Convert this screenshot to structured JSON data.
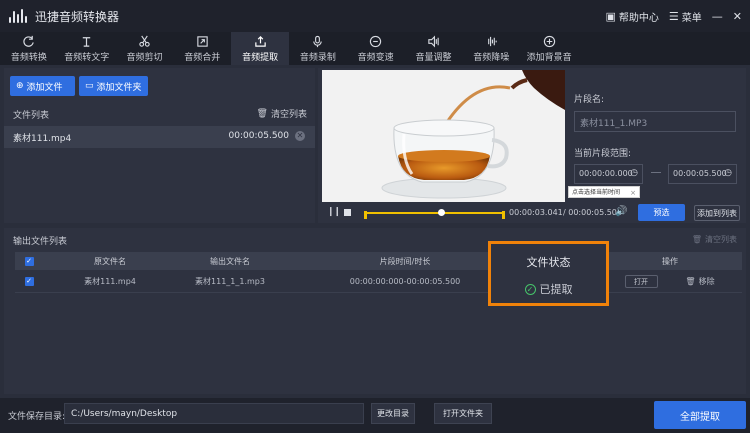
{
  "app": {
    "title": "迅捷音频转换器",
    "help_label": "帮助中心",
    "menu_label": "菜单"
  },
  "toolbar": {
    "tabs": [
      {
        "label": "音频转换",
        "icon": "refresh-icon"
      },
      {
        "label": "音频转文字",
        "icon": "text-icon"
      },
      {
        "label": "音频剪切",
        "icon": "scissors-icon"
      },
      {
        "label": "音频合并",
        "icon": "merge-icon"
      },
      {
        "label": "音频提取",
        "icon": "upload-icon",
        "active": true
      },
      {
        "label": "音频录制",
        "icon": "mic-icon"
      },
      {
        "label": "音频变速",
        "icon": "speed-icon"
      },
      {
        "label": "音量调整",
        "icon": "volume-icon"
      },
      {
        "label": "音频降噪",
        "icon": "noise-icon"
      },
      {
        "label": "添加背景音",
        "icon": "music-add-icon"
      }
    ]
  },
  "left": {
    "add_file": "添加文件",
    "add_folder": "添加文件夹",
    "list_title": "文件列表",
    "clear_list": "清空列表",
    "file": {
      "name": "素材111.mp4",
      "duration": "00:00:05.500"
    }
  },
  "player": {
    "current_time": "00:00:03.041",
    "total_time": "/ 00:00:05.504",
    "preview": "预选",
    "add_to_list": "添加到列表"
  },
  "segment": {
    "name_label": "片段名:",
    "name_value": "素材111_1.MP3",
    "range_label": "当前片段范围:",
    "start": "00:00:00.000",
    "end": "00:00:05.500",
    "tooltip": "点击选择当前时间"
  },
  "output": {
    "title": "输出文件列表",
    "clear": "清空列表",
    "columns": [
      "原文件名",
      "输出文件名",
      "片段时间/时长",
      "文件状态",
      "操作"
    ],
    "row": {
      "source": "素材111.mp4",
      "output": "素材111_1_1.mp3",
      "time": "00:00:00:000-00:00:05.500",
      "status": "已提取",
      "open": "打开",
      "remove": "移除"
    }
  },
  "bottom": {
    "save_label": "文件保存目录:",
    "save_path": "C:/Users/mayn/Desktop",
    "change_dir": "更改目录",
    "open_folder": "打开文件夹",
    "extract_all": "全部提取"
  },
  "colors": {
    "accent": "#2f6ee0",
    "highlight": "#f0820a",
    "success": "#46c36a",
    "timeline": "#f0c000"
  }
}
